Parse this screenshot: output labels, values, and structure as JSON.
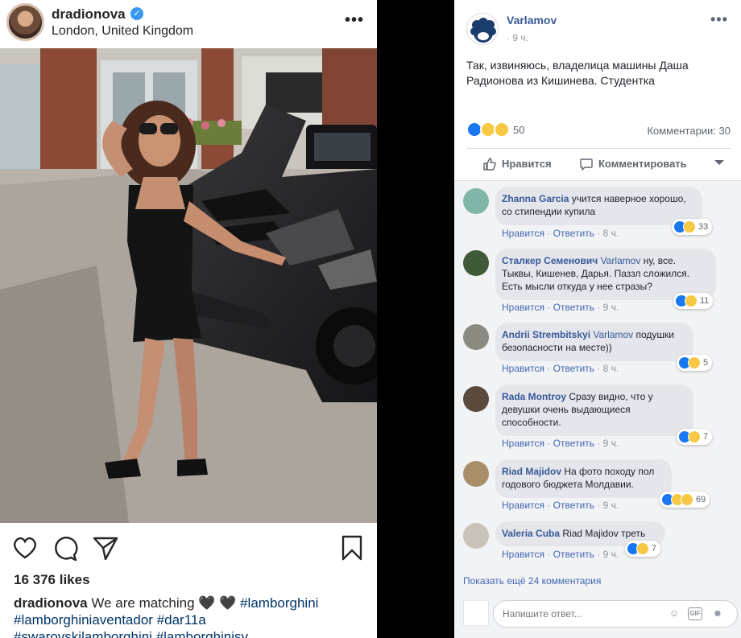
{
  "instagram": {
    "username": "dradionova",
    "verified": true,
    "location": "London, United Kingdom",
    "likes": "16 376 likes",
    "caption": {
      "username": "dradionova",
      "text": "We are matching",
      "emoji": "🖤 🖤",
      "tags": [
        "#lamborghini",
        "#lamborghiniaventador",
        "#dar11a",
        "#swarovskilamborghini",
        "#lamborghinisv"
      ]
    },
    "icons": [
      "heart-icon",
      "comment-icon",
      "share-icon",
      "bookmark-icon"
    ]
  },
  "facebook": {
    "author": "Varlamov",
    "time": "· 9 ч.",
    "text": "Так, извиняюсь, владелица машины Даша Радионова из Кишинева. Студентка",
    "reactions_count": "50",
    "comments_count": "Комментарии: 30",
    "like_label": "Нравится",
    "comment_label": "Комментировать",
    "comments": [
      {
        "name": "Zhanna Garcia",
        "mention": "",
        "text": "учится наверное хорошо, со стипендии купила",
        "reactions": "33",
        "like": "Нравится",
        "reply": "Ответить",
        "time": "8 ч."
      },
      {
        "name": "Сталкер Семенович",
        "mention": "Varlamov",
        "text": "ну, все. Тыквы, Кишенев, Дарья. Паззл сложился. Есть мысли откуда у нее стразы?",
        "reactions": "11",
        "like": "Нравится",
        "reply": "Ответить",
        "time": "9 ч."
      },
      {
        "name": "Andrii Strembitskyi",
        "mention": "Varlamov",
        "text": "подушки безопасности на месте))",
        "reactions": "5",
        "like": "Нравится",
        "reply": "Ответить",
        "time": "8 ч."
      },
      {
        "name": "Rada Montroy",
        "mention": "",
        "text": "Сразу видно, что у девушки очень выдающиеся способности.",
        "reactions": "7",
        "like": "Нравится",
        "reply": "Ответить",
        "time": "9 ч."
      },
      {
        "name": "Riad Majidov",
        "mention": "",
        "text": "На фото походу пол годового бюджета Молдавии.",
        "reactions": "69",
        "like": "Нравится",
        "reply": "Ответить",
        "time": "9 ч."
      },
      {
        "name": "Valeria Cuba",
        "mention": "",
        "text": "Riad Majidov треть",
        "reactions": "7",
        "like": "Нравится",
        "reply": "Ответить",
        "time": "9 ч."
      }
    ],
    "show_more": "Показать ещё 24 комментария",
    "reply_placeholder": "Напишите ответ...",
    "colors": {
      "link": "#385898",
      "like_blue": "#1877f2",
      "haha_yellow": "#f7c843",
      "angry_orange": "#e9710f"
    }
  }
}
